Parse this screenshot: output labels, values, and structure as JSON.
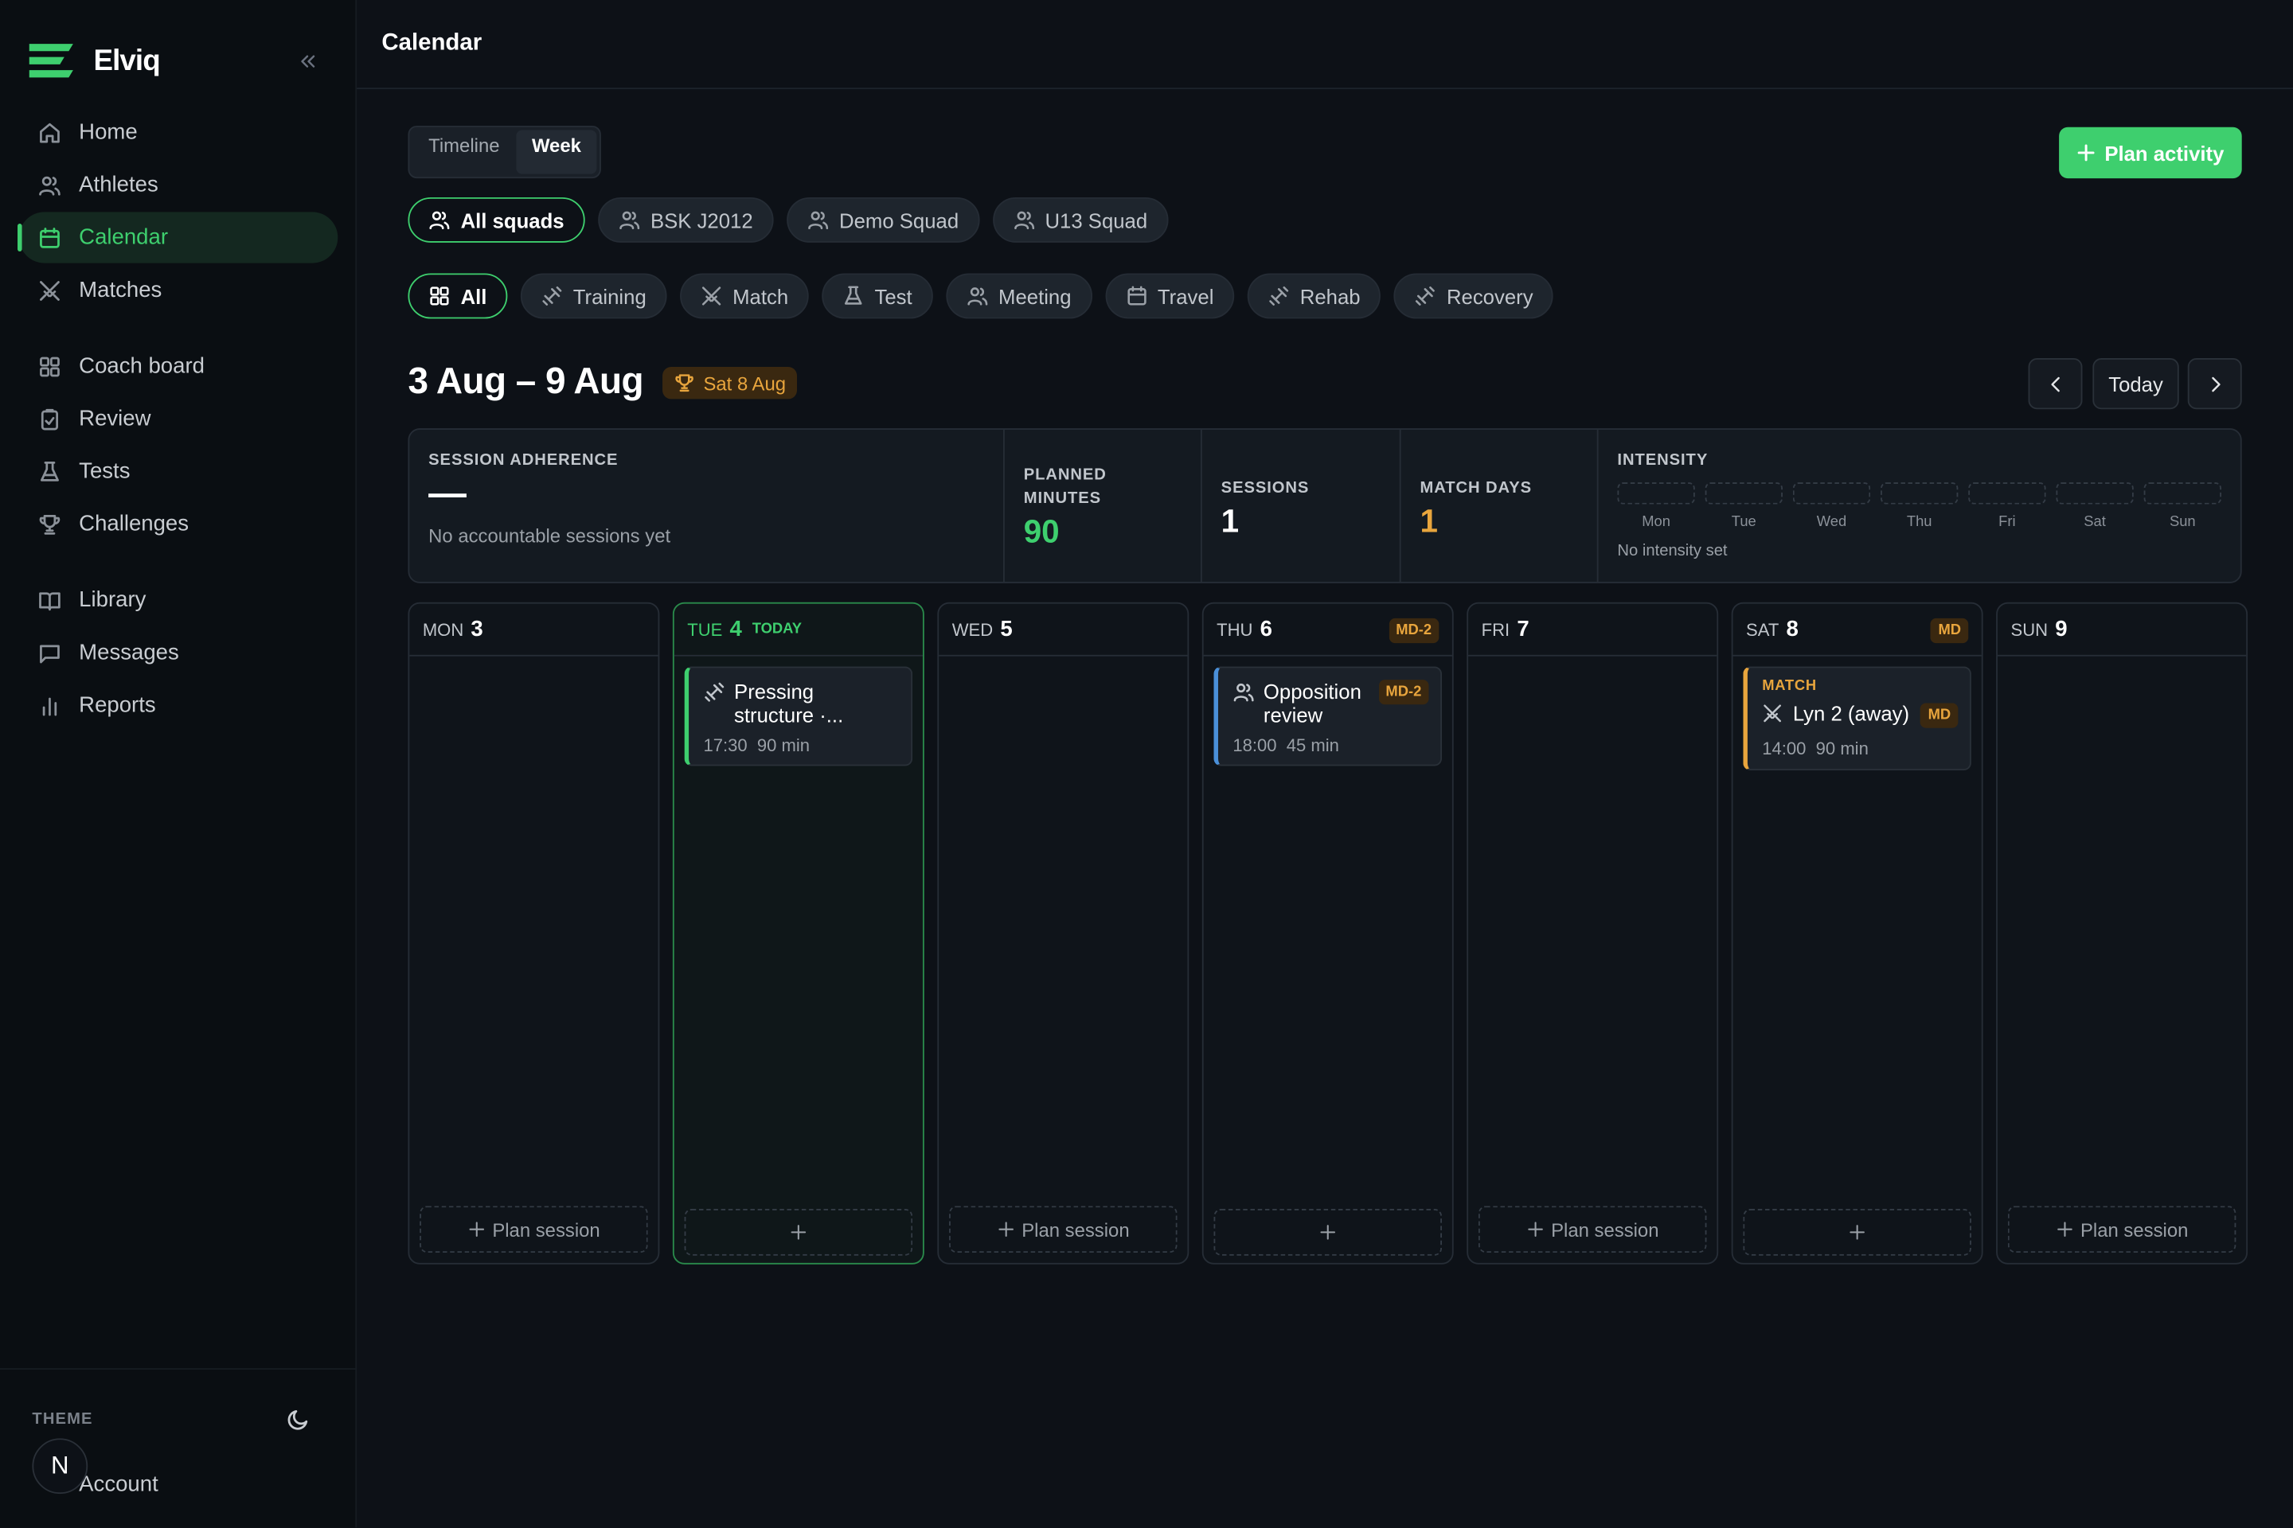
{
  "app": {
    "name": "Elviq"
  },
  "sidebar": {
    "nav_main": [
      {
        "label": "Home",
        "icon": "home-icon"
      },
      {
        "label": "Athletes",
        "icon": "users-icon"
      },
      {
        "label": "Calendar",
        "icon": "calendar-icon",
        "active": true
      },
      {
        "label": "Matches",
        "icon": "swords-icon"
      }
    ],
    "nav_tools": [
      {
        "label": "Coach board",
        "icon": "grid-icon"
      },
      {
        "label": "Review",
        "icon": "clipboard-check-icon"
      },
      {
        "label": "Tests",
        "icon": "flask-icon"
      },
      {
        "label": "Challenges",
        "icon": "trophy-icon"
      }
    ],
    "nav_other": [
      {
        "label": "Library",
        "icon": "book-icon"
      },
      {
        "label": "Messages",
        "icon": "message-icon"
      },
      {
        "label": "Reports",
        "icon": "bar-chart-icon"
      }
    ],
    "theme_label": "THEME",
    "account_label": "Account",
    "avatar_initial": "N"
  },
  "header": {
    "title": "Calendar"
  },
  "view_toggle": {
    "options": [
      "Timeline",
      "Week"
    ],
    "selected": "Week"
  },
  "plan_activity_label": "Plan activity",
  "squads": [
    {
      "label": "All squads",
      "active": true
    },
    {
      "label": "BSK J2012"
    },
    {
      "label": "Demo Squad"
    },
    {
      "label": "U13 Squad"
    }
  ],
  "types": [
    {
      "label": "All",
      "icon": "grid-icon",
      "active": true
    },
    {
      "label": "Training",
      "icon": "dumbbell-icon"
    },
    {
      "label": "Match",
      "icon": "swords-icon"
    },
    {
      "label": "Test",
      "icon": "flask-icon"
    },
    {
      "label": "Meeting",
      "icon": "users-icon"
    },
    {
      "label": "Travel",
      "icon": "calendar-icon"
    },
    {
      "label": "Rehab",
      "icon": "dumbbell-icon"
    },
    {
      "label": "Recovery",
      "icon": "dumbbell-icon"
    }
  ],
  "week": {
    "range": "3 Aug – 9 Aug",
    "match_badge": "Sat 8 Aug",
    "today_button": "Today"
  },
  "stats": {
    "adherence": {
      "label": "SESSION ADHERENCE",
      "value": "—",
      "note": "No accountable sessions yet"
    },
    "planned_minutes": {
      "label_line1": "PLANNED",
      "label_line2": "MINUTES",
      "value": "90"
    },
    "sessions": {
      "label": "SESSIONS",
      "value": "1"
    },
    "match_days": {
      "label": "MATCH DAYS",
      "value": "1"
    },
    "intensity": {
      "label": "INTENSITY",
      "days": [
        "Mon",
        "Tue",
        "Wed",
        "Thu",
        "Fri",
        "Sat",
        "Sun"
      ],
      "note": "No intensity set"
    }
  },
  "days": [
    {
      "dow": "MON",
      "num": "3",
      "slot": "Plan session"
    },
    {
      "dow": "TUE",
      "num": "4",
      "today_label": "TODAY",
      "slot": "",
      "event": {
        "title_line1": "Pressing",
        "title_line2": "structure ·...",
        "time": "17:30",
        "duration": "90 min",
        "icon": "dumbbell-icon",
        "accent": "#3ecf6e"
      }
    },
    {
      "dow": "WED",
      "num": "5",
      "slot": "Plan session"
    },
    {
      "dow": "THU",
      "num": "6",
      "md_tag": "MD-2",
      "slot": "",
      "event": {
        "title_line1": "Opposition",
        "title_line2": "review",
        "tag": "MD-2",
        "time": "18:00",
        "duration": "45 min",
        "icon": "users-icon",
        "accent": "#4a90d9"
      }
    },
    {
      "dow": "FRI",
      "num": "7",
      "slot": "Plan session"
    },
    {
      "dow": "SAT",
      "num": "8",
      "md_tag": "MD",
      "slot": "",
      "event": {
        "kind": "MATCH",
        "title_line1": "Lyn 2 (away)",
        "tag": "MD",
        "time": "14:00",
        "duration": "90 min",
        "icon": "swords-icon",
        "accent": "#e8a53d"
      }
    },
    {
      "dow": "SUN",
      "num": "9",
      "slot": "Plan session"
    }
  ],
  "colors": {
    "accent": "#3ecf6e",
    "match": "#e8a53d",
    "meeting": "#4a90d9",
    "background": "#0d1117"
  }
}
